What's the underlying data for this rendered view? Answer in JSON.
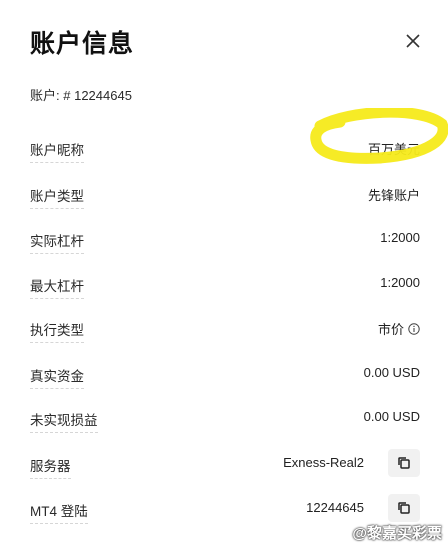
{
  "dialog": {
    "title": "账户信息",
    "account_prefix": "账户: #",
    "account_number": "12244645"
  },
  "rows": [
    {
      "label": "账户昵称",
      "value": "百万美元"
    },
    {
      "label": "账户类型",
      "value": "先锋账户"
    },
    {
      "label": "实际杠杆",
      "value": "1:2000"
    },
    {
      "label": "最大杠杆",
      "value": "1:2000"
    },
    {
      "label": "执行类型",
      "value": "市价"
    },
    {
      "label": "真实资金",
      "value": "0.00 USD"
    },
    {
      "label": "未实现损益",
      "value": "0.00 USD"
    },
    {
      "label": "服务器",
      "value": "Exness-Real2"
    },
    {
      "label": "MT4 登陆",
      "value": "12244645"
    }
  ],
  "watermark": "@黎嘉买彩票",
  "colors": {
    "highlight": "#f5ea1a",
    "copy_bg": "#f1f1f1"
  },
  "icons": {
    "close": "close-icon",
    "info": "info-icon",
    "copy": "copy-icon"
  }
}
